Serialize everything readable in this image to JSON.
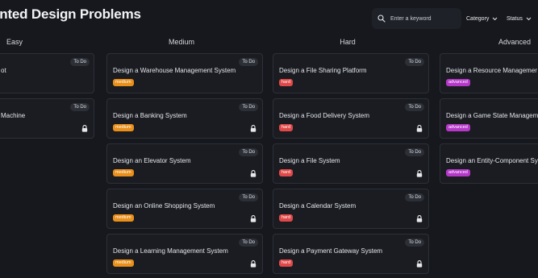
{
  "header": {
    "title": "ented Design Problems",
    "search_placeholder": "Enter a keyword",
    "filter_category": "Category",
    "filter_status": "Status"
  },
  "columns": [
    {
      "name": "Easy",
      "cards": [
        {
          "title": "ot",
          "status": "To Do",
          "difficulty": "",
          "locked": false
        },
        {
          "title": "Machine",
          "status": "To Do",
          "difficulty": "",
          "locked": true
        }
      ]
    },
    {
      "name": "Medium",
      "cards": [
        {
          "title": "Design a Warehouse Management System",
          "status": "To Do",
          "difficulty": "medium",
          "locked": false
        },
        {
          "title": "Design a Banking System",
          "status": "To Do",
          "difficulty": "medium",
          "locked": true
        },
        {
          "title": "Design an Elevator System",
          "status": "To Do",
          "difficulty": "medium",
          "locked": true
        },
        {
          "title": "Design an Online Shopping System",
          "status": "To Do",
          "difficulty": "medium",
          "locked": true
        },
        {
          "title": "Design a Learning Management System",
          "status": "To Do",
          "difficulty": "medium",
          "locked": true
        }
      ]
    },
    {
      "name": "Hard",
      "cards": [
        {
          "title": "Design a File Sharing Platform",
          "status": "To Do",
          "difficulty": "hard",
          "locked": false
        },
        {
          "title": "Design a Food Delivery System",
          "status": "To Do",
          "difficulty": "hard",
          "locked": true
        },
        {
          "title": "Design a File System",
          "status": "To Do",
          "difficulty": "hard",
          "locked": true
        },
        {
          "title": "Design a Calendar System",
          "status": "To Do",
          "difficulty": "hard",
          "locked": true
        },
        {
          "title": "Design a Payment Gateway System",
          "status": "To Do",
          "difficulty": "hard",
          "locked": true
        }
      ]
    },
    {
      "name": "Advanced",
      "cards": [
        {
          "title": "Design a Resource Managemer",
          "status": "",
          "difficulty": "advanced",
          "locked": false
        },
        {
          "title": "Design a Game State Managem",
          "status": "",
          "difficulty": "advanced",
          "locked": false
        },
        {
          "title": "Design an Entity-Component Sy",
          "status": "",
          "difficulty": "advanced",
          "locked": false
        }
      ]
    }
  ],
  "colors": {
    "background": "#16181d",
    "card": "#1a1c21",
    "medium": "#e98f1a",
    "hard": "#e04949",
    "advanced": "#b538c9"
  }
}
